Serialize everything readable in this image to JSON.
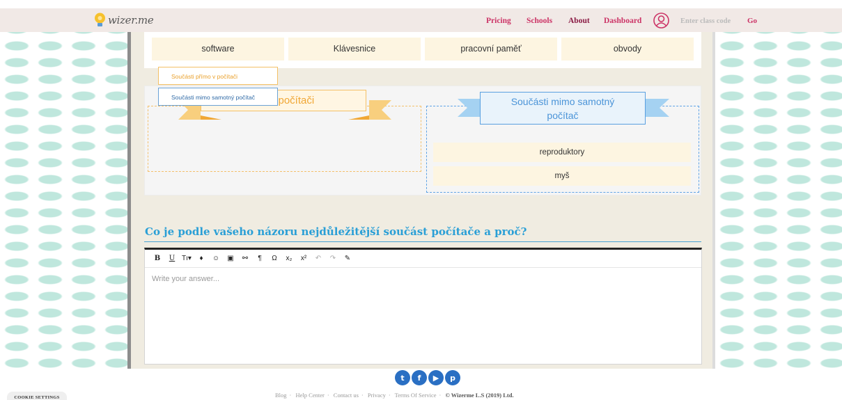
{
  "header": {
    "logo_text": "wizer.me",
    "nav": [
      "Pricing",
      "Schools",
      "About",
      "Dashboard"
    ],
    "active_nav": "About",
    "class_code_placeholder": "Enter class code",
    "go_label": "Go"
  },
  "categories": [
    "software",
    "Klávesnice",
    "pracovní paměť",
    "obvody"
  ],
  "dropdown": {
    "options": [
      "Součásti přímo v počítači",
      "Součásti mimo samotný počítač"
    ]
  },
  "zones": {
    "left_title": "mo v počítači",
    "right_title_line1": "Součásti mimo samotný",
    "right_title_line2": "počítač",
    "right_items": [
      "reproduktory",
      "myš"
    ]
  },
  "question": "Co je podle vašeho názoru nejdůležitější součást počítače a proč?",
  "editor": {
    "placeholder": "Write your answer...",
    "tools": [
      "B",
      "U",
      "Tı▾",
      "♦",
      "☺",
      "▣",
      "⚯",
      "¶",
      "Ω",
      "x₂",
      "x²",
      "↶",
      "↷",
      "✎"
    ]
  },
  "footer": {
    "links": [
      "Blog",
      "Help Center",
      "Contact us",
      "Privacy",
      "Terms Of Service"
    ],
    "copyright": "© Wizerme L.S (2019) Ltd.",
    "cookie_label": "COOKIE SETTINGS",
    "social": [
      "twitter-icon",
      "facebook-icon",
      "youtube-icon",
      "pinterest-icon"
    ]
  },
  "colors": {
    "brand": "#cc3366",
    "question_blue": "#2a9fd6",
    "orange": "#f3c066",
    "blue": "#5aa0e0",
    "pattern": "#bfe7dd"
  }
}
